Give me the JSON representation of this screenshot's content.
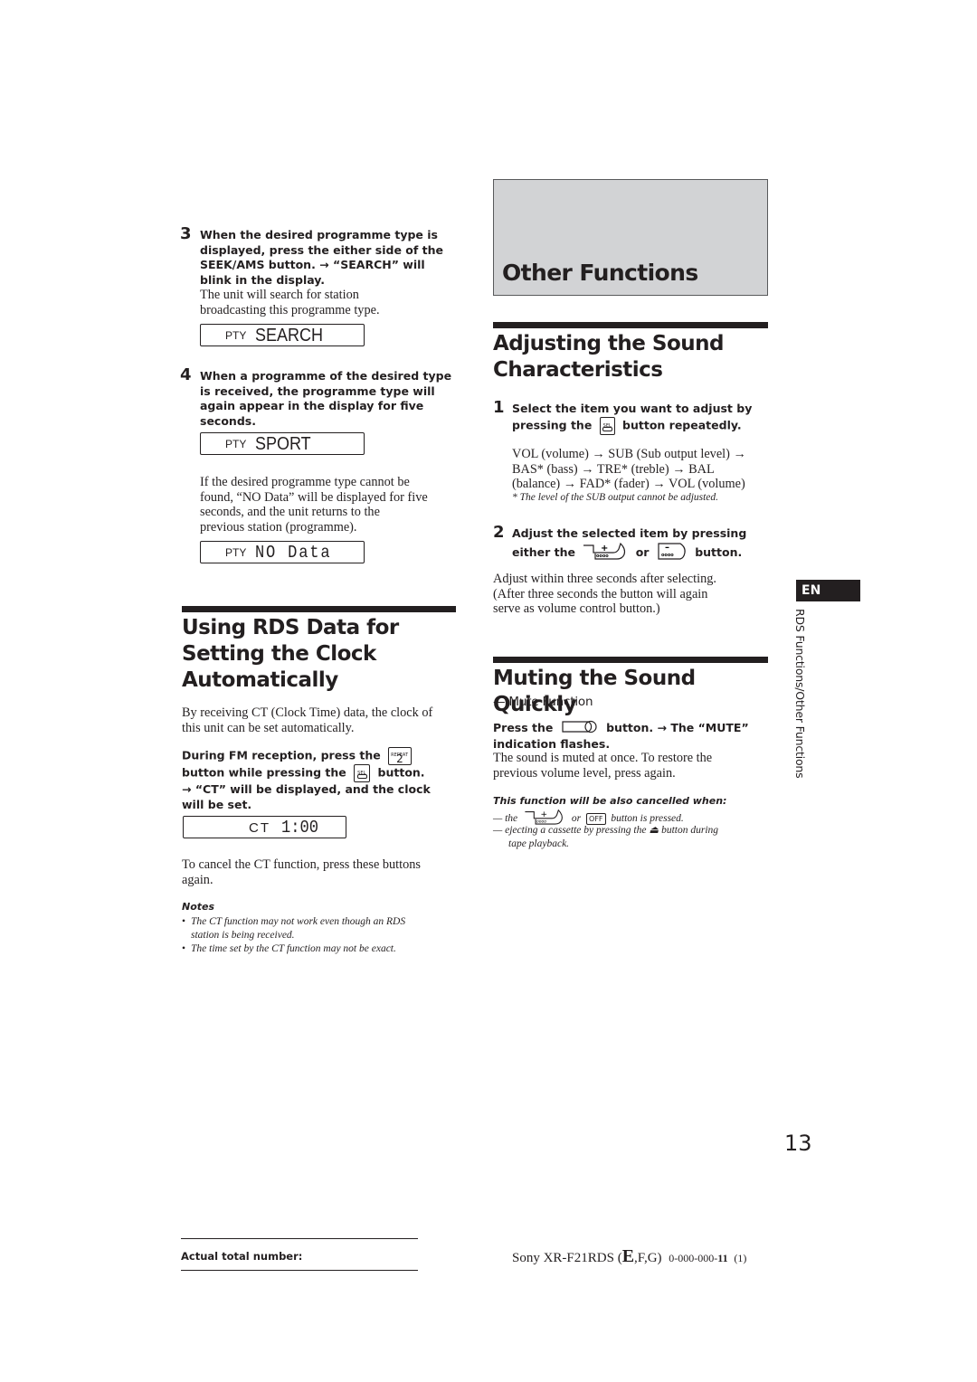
{
  "left_column": {
    "step3": {
      "number": "3",
      "instruction": "When the desired programme type is displayed, press the either side of the SEEK/AMS button. → “SEARCH” will blink in the display.",
      "lines": [
        "When the desired programme type is",
        "displayed, press the either side of the",
        "SEEK/AMS button. → “SEARCH” will",
        "blink in the display."
      ],
      "body_lines": [
        "The unit will search for station",
        "broadcasting this programme type."
      ],
      "display": {
        "label": "PTY",
        "value": "SEARCH"
      }
    },
    "step4": {
      "number": "4",
      "lines": [
        "When a programme of the desired type",
        "is received, the programme type will",
        "again appear in the display for five",
        "seconds."
      ],
      "display": {
        "label": "PTY",
        "value": "SPORT"
      },
      "body_lines": [
        "If the desired programme type cannot be",
        "found, “NO Data” will be displayed for five",
        "seconds, and the unit returns to the",
        "previous station (programme)."
      ],
      "display2": {
        "label": "PTY",
        "value": "NO Data"
      }
    },
    "rds_clock": {
      "heading_lines": [
        "Using RDS Data for",
        "Setting the Clock",
        "Automatically"
      ],
      "intro_lines": [
        "By receiving CT (Clock Time) data, the clock of",
        "this unit can be set automatically."
      ],
      "instr_line1_a": "During FM reception, press the",
      "repeat_key_top": "REPEAT",
      "repeat_key_num": "2",
      "instr_line2_a": "button while pressing the",
      "sel_key": "SEL",
      "instr_line2_b": "button.",
      "instr_line3": "→ “CT” will be displayed, and the clock",
      "instr_line4": "will be set.",
      "display": {
        "label": "CT",
        "value": "1:00"
      },
      "cancel_lines": [
        "To cancel the CT function, press these buttons",
        "again."
      ],
      "notes_title": "Notes",
      "notes": [
        {
          "lines": [
            "The CT function may not work even though an RDS",
            "station is being received."
          ]
        },
        {
          "lines": [
            "The time set by the CT function may not be exact."
          ]
        }
      ]
    }
  },
  "right_column": {
    "chapter_title": "Other Functions",
    "adjust": {
      "heading_lines": [
        "Adjusting the Sound",
        "Characteristics"
      ],
      "step1": {
        "number": "1",
        "line1": "Select the item you want to adjust by",
        "line2_a": "pressing the",
        "sel_key": "SEL",
        "line2_b": "button repeatedly.",
        "sequence_lines": [
          "VOL (volume) → SUB (Sub output level) →",
          "BAS* (bass) → TRE* (treble)  → BAL",
          "(balance) → FAD* (fader) → VOL (volume)"
        ],
        "footnote": "* The level of the SUB output cannot be adjusted."
      },
      "step2": {
        "number": "2",
        "line1": "Adjust the selected item by pressing",
        "line2_a": "either the",
        "plus_key": "+",
        "or": "or",
        "minus_key": "–",
        "line2_b": "button.",
        "body_lines": [
          "Adjust within three seconds after selecting.",
          "(After three seconds the button will again",
          "serve as volume control button.)"
        ]
      }
    },
    "mute": {
      "heading": "Muting the Sound Quickly",
      "subheading": "— Mute Function",
      "instr_a": "Press the",
      "mute_key": "MUTE",
      "instr_b": "button. → The “MUTE”",
      "instr_line2": "indication flashes.",
      "body_lines": [
        "The sound is muted at once. To restore the",
        "previous volume level, press again."
      ],
      "cancel_title": "This function will be also cancelled when:",
      "cancel_item1_a": "— the",
      "cancel_item1_or": "or",
      "off_key": "OFF",
      "cancel_item1_b": "button is pressed.",
      "cancel_item2_lines": [
        "— ejecting a cassette by pressing the ⏏ button during",
        "tape playback."
      ]
    }
  },
  "side_tab": {
    "language": "EN",
    "section": "RDS Functions/Other Functions"
  },
  "page_number": "13",
  "footer": {
    "actual_total_label": "Actual total number:",
    "model_prefix": "Sony XR-F21RDS (",
    "model_E": "E",
    "model_suffix": ",F,G)",
    "code_prefix": "0-000-000-",
    "code_bold": "11",
    "code_suffix": "(1)"
  }
}
